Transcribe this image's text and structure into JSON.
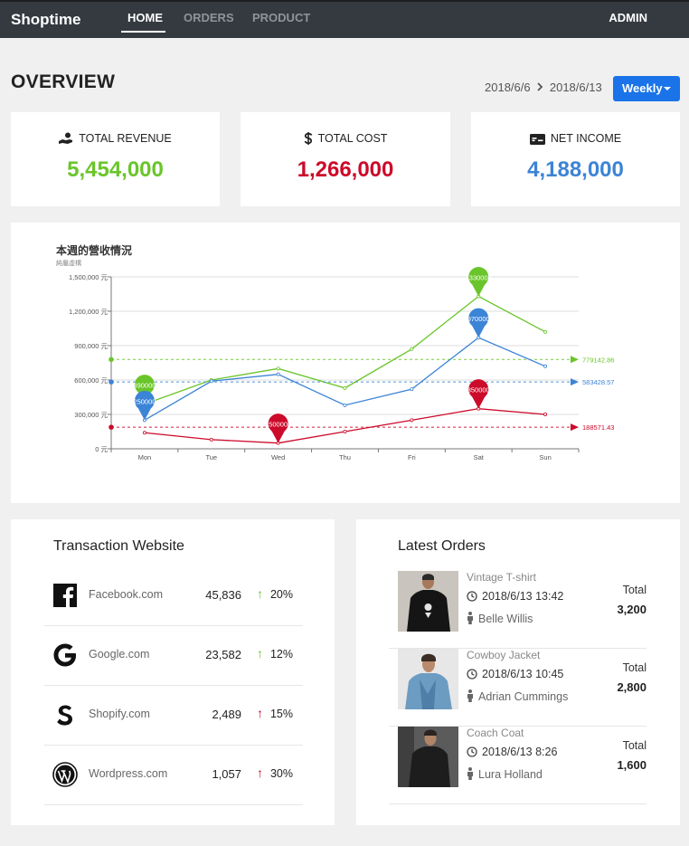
{
  "nav": {
    "brand": "Shoptime",
    "items": [
      {
        "label": "HOME"
      },
      {
        "label": "ORDERS"
      },
      {
        "label": "PRODUCT"
      }
    ],
    "user": "ADMIN"
  },
  "overview": {
    "title": "OVERVIEW",
    "date_from": "2018/6/6",
    "date_to": "2018/6/13",
    "period": "Weekly"
  },
  "kpis": [
    {
      "label": "TOTAL REVENUE",
      "value": "5,454,000",
      "color": "#6ac52a",
      "icon": "hand-coin-icon"
    },
    {
      "label": "TOTAL COST",
      "value": "1,266,000",
      "color": "#cc0a2a",
      "icon": "dollar-icon"
    },
    {
      "label": "NET INCOME",
      "value": "4,188,000",
      "color": "#3c84d6",
      "icon": "money-bill-icon"
    }
  ],
  "chart_data": {
    "type": "line",
    "title": "本週的營收情況",
    "subtitle": "純屬虛構",
    "categories": [
      "Mon",
      "Tue",
      "Wed",
      "Thu",
      "Fri",
      "Sat",
      "Sun"
    ],
    "y_ticks": [
      "0 元",
      "300,000 元",
      "600,000 元",
      "900,000 元",
      "1,200,000 元",
      "1,500,000 元"
    ],
    "ylim": [
      0,
      1500000
    ],
    "grid": true,
    "series": [
      {
        "color": "#6ac52a",
        "values": [
          390000,
          600000,
          700000,
          530000,
          870000,
          1330000,
          1020000
        ],
        "max_label": "1330000",
        "min_label": "390000",
        "average": 779142.86,
        "average_label": "779142.86"
      },
      {
        "color": "#3c84d6",
        "values": [
          250000,
          590000,
          650000,
          380000,
          520000,
          970000,
          720000
        ],
        "max_label": "970000",
        "min_label": "250000",
        "average": 583428.57,
        "average_label": "583428.57"
      },
      {
        "color": "#cc0a2a",
        "values": [
          140000,
          80000,
          50000,
          150000,
          250000,
          350000,
          300000
        ],
        "max_label": "350000",
        "min_label": "50000",
        "average": 188571.43,
        "average_label": "188571.43"
      }
    ]
  },
  "transactions": {
    "title": "Transaction Website",
    "sites": [
      {
        "name": "Facebook.com",
        "count": "45,836",
        "pct": "20%",
        "trend_color": "#6ac52a",
        "icon": "facebook-icon"
      },
      {
        "name": "Google.com",
        "count": "23,582",
        "pct": "12%",
        "trend_color": "#6ac52a",
        "icon": "google-icon"
      },
      {
        "name": "Shopify.com",
        "count": "2,489",
        "pct": "15%",
        "trend_color": "#cc0a2a",
        "icon": "shopify-icon"
      },
      {
        "name": "Wordpress.com",
        "count": "1,057",
        "pct": "30%",
        "trend_color": "#cc0a2a",
        "icon": "wordpress-icon"
      }
    ]
  },
  "orders": {
    "title": "Latest Orders",
    "total_label": "Total",
    "items": [
      {
        "product": "Vintage T-shirt",
        "time": "2018/6/13 13:42",
        "customer": "Belle Willis",
        "total": "3,200"
      },
      {
        "product": "Cowboy Jacket",
        "time": "2018/6/13 10:45",
        "customer": "Adrian Cummings",
        "total": "2,800"
      },
      {
        "product": "Coach Coat",
        "time": "2018/6/13 8:26",
        "customer": "Lura Holland",
        "total": "1,600"
      }
    ]
  }
}
